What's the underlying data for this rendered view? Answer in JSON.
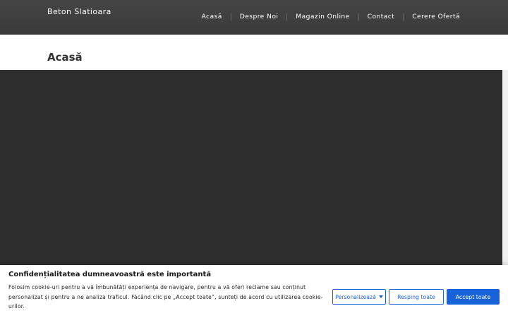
{
  "header": {
    "site_title": "Beton Slatioara",
    "nav": [
      {
        "label": "Acasă"
      },
      {
        "label": "Despre Noi"
      },
      {
        "label": "Magazin Online"
      },
      {
        "label": "Contact"
      },
      {
        "label": "Cerere Ofertă"
      }
    ]
  },
  "page": {
    "title": "Acasă"
  },
  "cookie_banner": {
    "title": "Confidențialitatea dumneavoastră este importantă",
    "text": "Folosim cookie-uri pentru a vă îmbunătăți experiența de navigare, pentru a vă oferi reclame sau conținut personalizat și pentru a ne analiza traficul. Făcând clic pe „Accept toate”, sunteți de acord cu utilizarea cookie-urilor.",
    "customize_label": "Personalizează",
    "reject_label": "Resping toate",
    "accept_label": "Accept toate"
  },
  "colors": {
    "header_bg": "#3f3f3f",
    "hero_bg": "#2e2e2e",
    "accent": "#1863dc"
  }
}
